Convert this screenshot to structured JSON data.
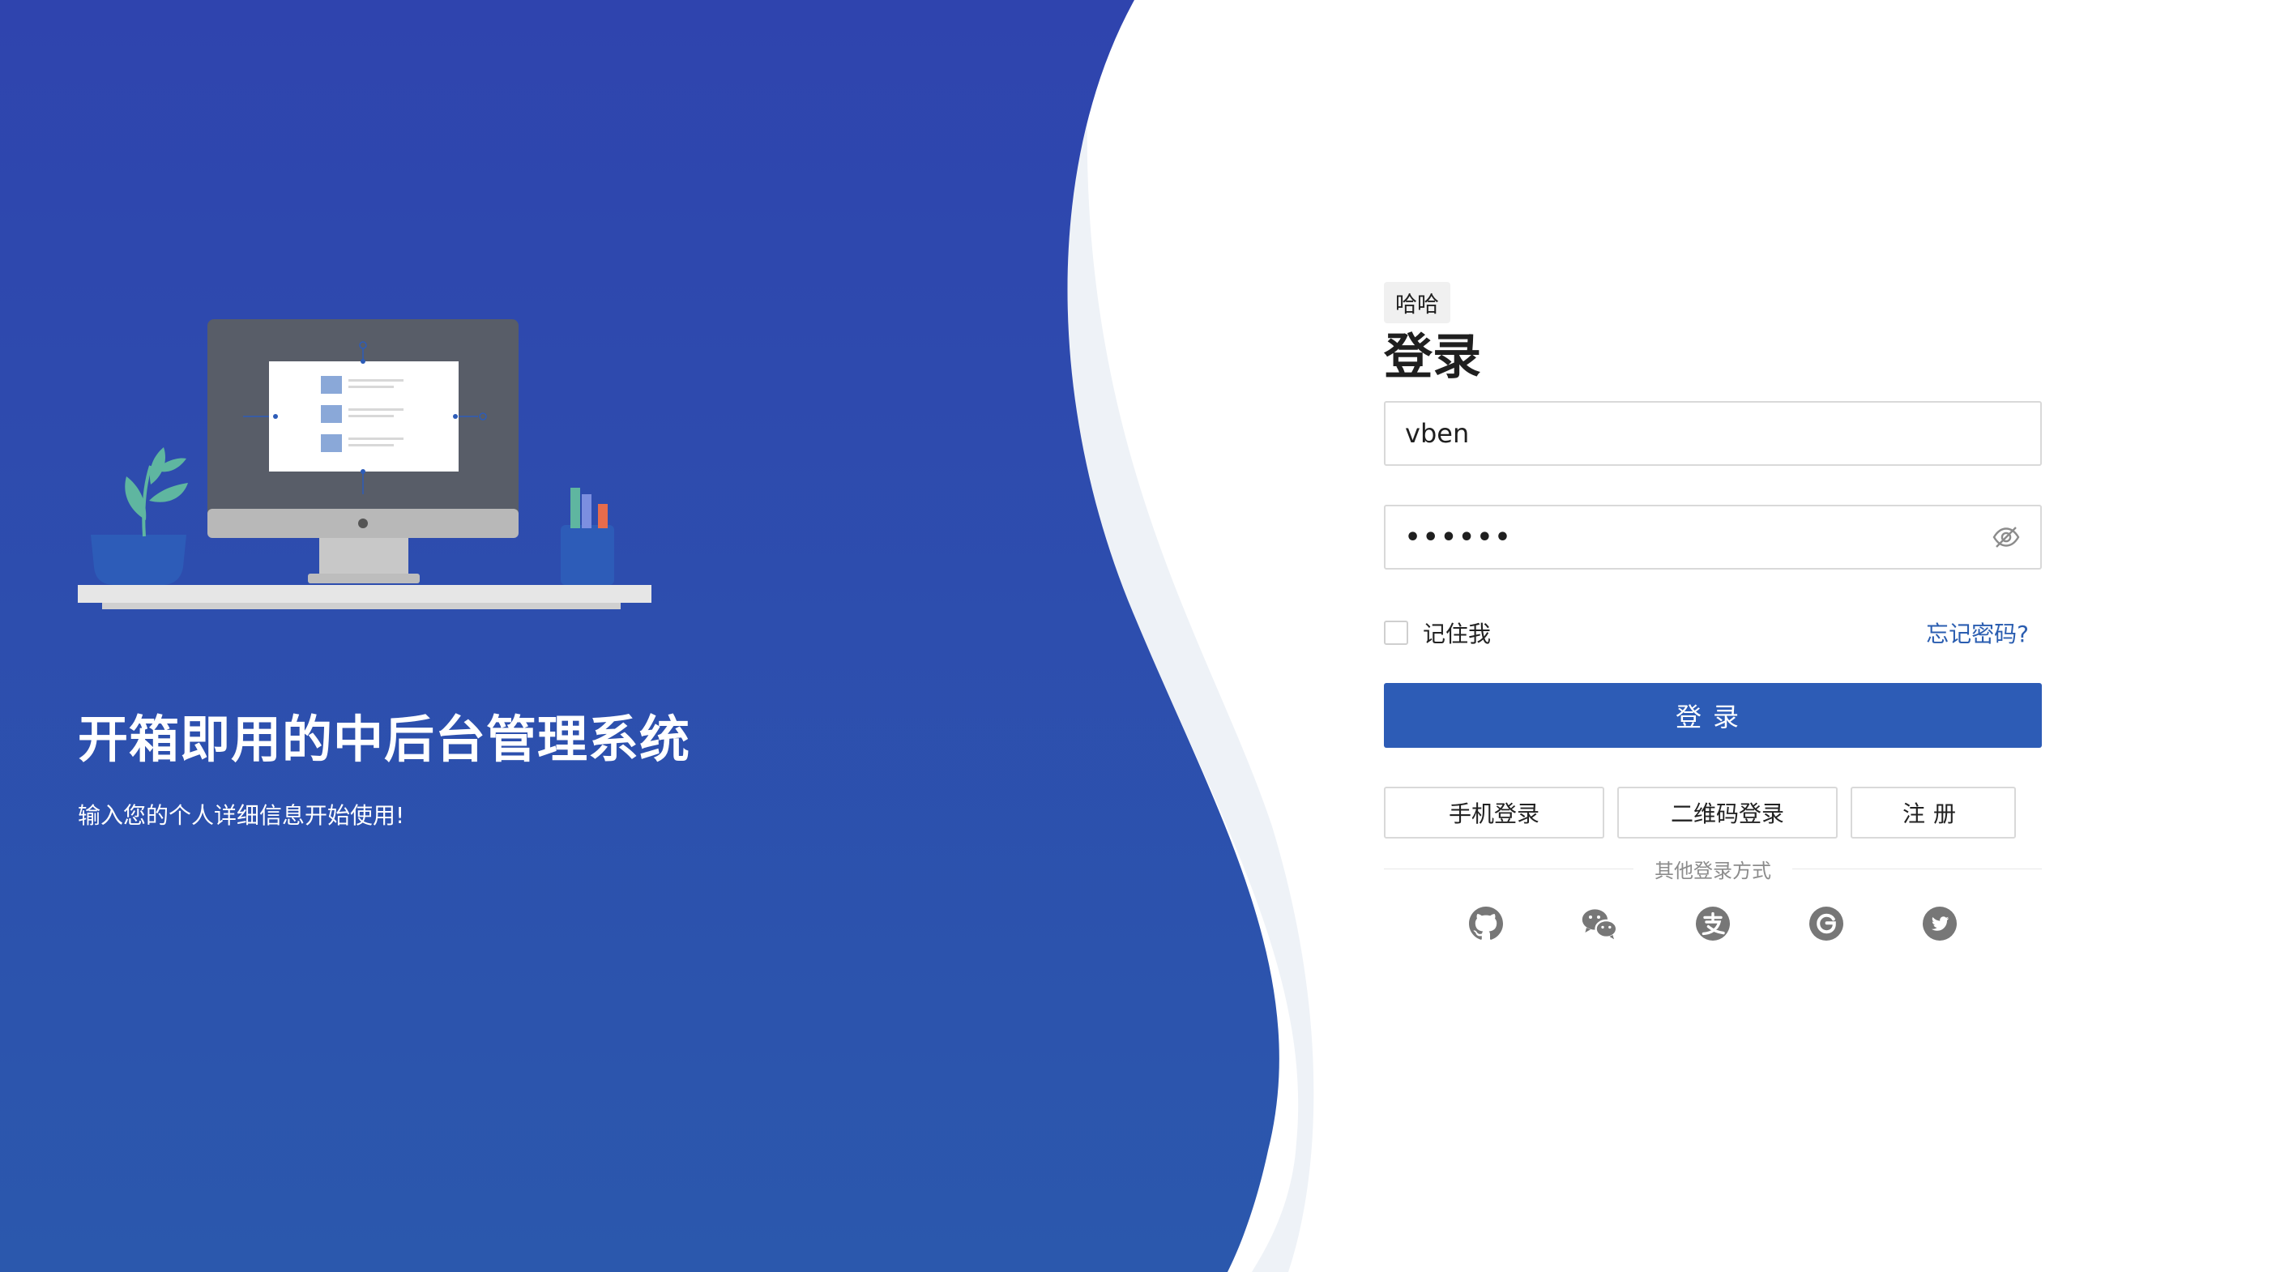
{
  "hero": {
    "title": "开箱即用的中后台管理系统",
    "subtitle": "输入您的个人详细信息开始使用!"
  },
  "login": {
    "app_tag": "哈哈",
    "title": "登录",
    "username_value": "vben",
    "password_masked": "••••••",
    "remember_label": "记住我",
    "forgot_label": "忘记密码?",
    "submit_label": "登录",
    "alt_methods": [
      "手机登录",
      "二维码登录",
      "注册"
    ],
    "other_methods_label": "其他登录方式",
    "social_icons": [
      "github-icon",
      "wechat-icon",
      "alipay-icon",
      "google-icon",
      "twitter-icon"
    ]
  },
  "colors": {
    "hero_bg_top": "#2f45ae",
    "hero_bg_bottom": "#2b58ad",
    "primary": "#2d5cb6",
    "link": "#2a5db0",
    "social_icon": "#777777"
  }
}
